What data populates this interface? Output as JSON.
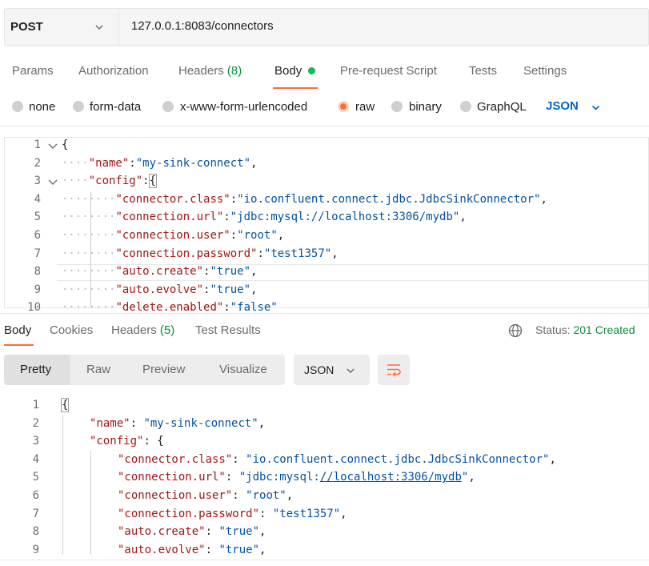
{
  "request": {
    "method": "POST",
    "url": "127.0.0.1:8083/connectors"
  },
  "request_tabs": [
    {
      "label": "Params"
    },
    {
      "label": "Authorization"
    },
    {
      "label": "Headers",
      "count": "(8)"
    },
    {
      "label": "Body"
    },
    {
      "label": "Pre-request Script"
    },
    {
      "label": "Tests"
    },
    {
      "label": "Settings"
    }
  ],
  "body_types": [
    {
      "label": "none"
    },
    {
      "label": "form-data"
    },
    {
      "label": "x-www-form-urlencoded"
    },
    {
      "label": "raw",
      "selected": true
    },
    {
      "label": "binary"
    },
    {
      "label": "GraphQL"
    }
  ],
  "body_format": "JSON",
  "request_body": {
    "line_numbers": [
      "1",
      "2",
      "3",
      "4",
      "5",
      "6",
      "7",
      "8",
      "9",
      "10"
    ],
    "lines": [
      {
        "open": "{"
      },
      {
        "key": "\"name\"",
        "sep": ":",
        "value": "\"my-sink-connect\"",
        "end": ","
      },
      {
        "key": "\"config\"",
        "sep": ":",
        "value": "{",
        "end": ""
      },
      {
        "key": "\"connector.class\"",
        "sep": ":",
        "value": "\"io.confluent.connect.jdbc.JdbcSinkConnector\"",
        "end": ","
      },
      {
        "key": "\"connection.url\"",
        "sep": ":",
        "value": "\"jdbc:mysql://localhost:3306/mydb\"",
        "end": ","
      },
      {
        "key": "\"connection.user\"",
        "sep": ":",
        "value": "\"root\"",
        "end": ","
      },
      {
        "key": "\"connection.password\"",
        "sep": ":",
        "value": "\"test1357\"",
        "end": ","
      },
      {
        "key": "\"auto.create\"",
        "sep": ":",
        "value": "\"true\"",
        "end": ","
      },
      {
        "key": "\"auto.evolve\"",
        "sep": ":",
        "value": "\"true\"",
        "end": ","
      },
      {
        "key": "\"delete.enabled\"",
        "sep": ":",
        "value": "\"false\"",
        "end": ""
      }
    ]
  },
  "response_tabs": [
    {
      "label": "Body"
    },
    {
      "label": "Cookies"
    },
    {
      "label": "Headers",
      "count": "(5)"
    },
    {
      "label": "Test Results"
    }
  ],
  "status": {
    "label": "Status:",
    "value": "201 Created"
  },
  "view_modes": [
    "Pretty",
    "Raw",
    "Preview",
    "Visualize"
  ],
  "response_format": "JSON",
  "response_body": {
    "line_numbers": [
      "1",
      "2",
      "3",
      "4",
      "5",
      "6",
      "7",
      "8",
      "9"
    ],
    "lines": [
      {
        "open": "{"
      },
      {
        "key": "\"name\"",
        "sep": ": ",
        "value": "\"my-sink-connect\"",
        "end": ","
      },
      {
        "key": "\"config\"",
        "sep": ": ",
        "value": "{",
        "end": ""
      },
      {
        "key": "\"connector.class\"",
        "sep": ": ",
        "value": "\"io.confluent.connect.jdbc.JdbcSinkConnector\"",
        "end": ","
      },
      {
        "key": "\"connection.url\"",
        "sep": ": ",
        "value_pre": "\"jdbc:mysql:",
        "value_link": "//localhost:3306/mydb",
        "value_post": "\"",
        "end": ","
      },
      {
        "key": "\"connection.user\"",
        "sep": ": ",
        "value": "\"root\"",
        "end": ","
      },
      {
        "key": "\"connection.password\"",
        "sep": ": ",
        "value": "\"test1357\"",
        "end": ","
      },
      {
        "key": "\"auto.create\"",
        "sep": ": ",
        "value": "\"true\"",
        "end": ","
      },
      {
        "key": "\"auto.evolve\"",
        "sep": ": ",
        "value": "\"true\"",
        "end": ","
      }
    ]
  },
  "colors": {
    "accent": "#ff6c37",
    "link_blue": "#0265d2",
    "success_green": "#0a8f3a",
    "json_key": "#a31515",
    "json_string": "#0451a5"
  },
  "icons": [
    "chevron-down-icon",
    "fold-chevron-icon",
    "globe-icon",
    "wrap-lines-icon"
  ]
}
